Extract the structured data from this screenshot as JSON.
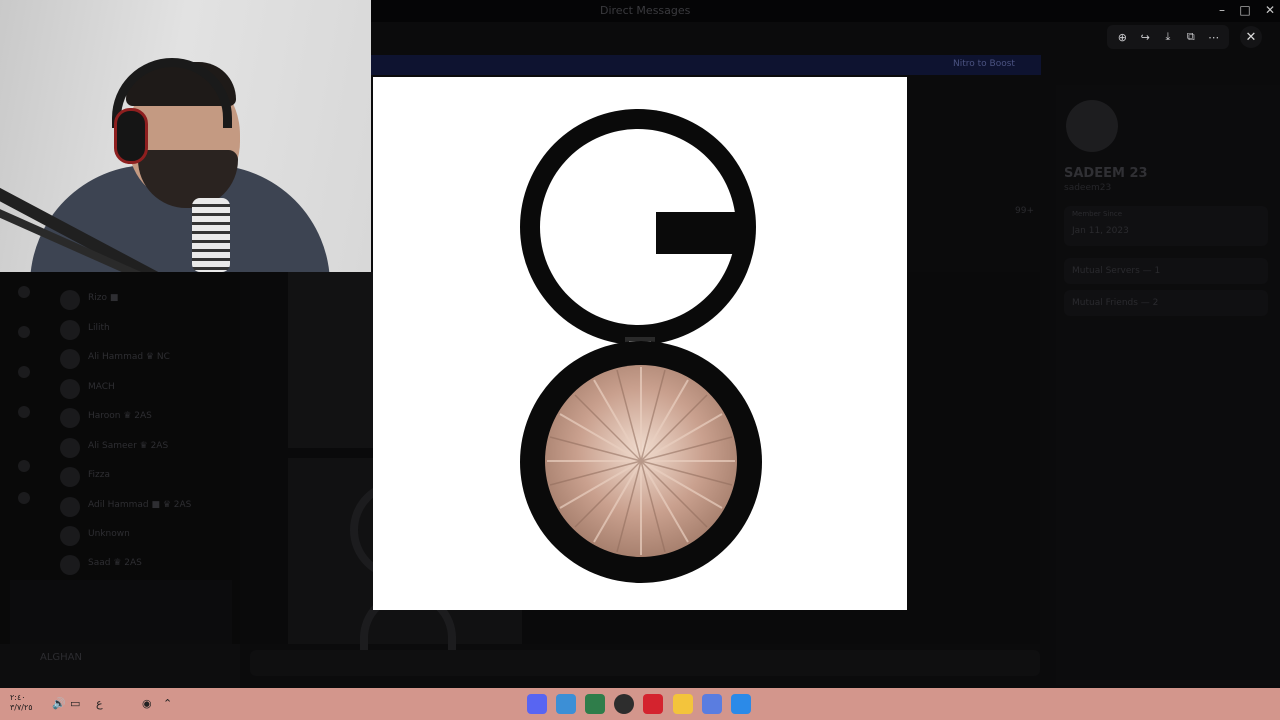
{
  "app": {
    "window_title": "Direct Messages",
    "banner_text": "Nitro to Boost"
  },
  "window_controls": {
    "minimize": "–",
    "maximize": "□",
    "close": "✕"
  },
  "dm_list": [
    {
      "name": "Rizo ■"
    },
    {
      "name": "Lilith"
    },
    {
      "name": "Ali Hammad ♛ NC"
    },
    {
      "name": "MACH"
    },
    {
      "name": "Haroon ♛ 2AS"
    },
    {
      "name": "Ali Sameer ♛ 2AS"
    },
    {
      "name": "Fizza"
    },
    {
      "name": "Adil Hammad ■ ♛ 2AS"
    },
    {
      "name": "Unknown"
    },
    {
      "name": "Saad ♛ 2AS"
    }
  ],
  "user_panel": {
    "username": "ALGHAN"
  },
  "profile": {
    "name": "SADEEM 23",
    "handle": "sadeem23",
    "member_since_label": "Member Since",
    "member_since": "Jan 11, 2023",
    "mutual_servers": "Mutual Servers — 1",
    "mutual_friends": "Mutual Friends — 2"
  },
  "online_count": "99+",
  "viewer": {
    "image_subject": "makeup-compact-highlighter",
    "toolbar": [
      {
        "icon": "zoom-in-icon",
        "glyph": "⊕"
      },
      {
        "icon": "forward-icon",
        "glyph": "↪"
      },
      {
        "icon": "download-icon",
        "glyph": "⤓"
      },
      {
        "icon": "open-external-icon",
        "glyph": "⧉"
      },
      {
        "icon": "more-icon",
        "glyph": "⋯"
      }
    ],
    "close_glyph": "✕"
  },
  "taskbar": {
    "clock_line1": "٢:٤٠",
    "clock_line2": "٣/٧/٢٥",
    "lang": "ع",
    "apps": [
      {
        "name": "discord-app-icon",
        "color": "#5865f2"
      },
      {
        "name": "game-app-icon",
        "color": "#3c8fd6"
      },
      {
        "name": "app-icon-3",
        "color": "#2f7d4a"
      },
      {
        "name": "obs-app-icon",
        "color": "#2d2d2d"
      },
      {
        "name": "adobe-app-icon",
        "color": "#d4232e"
      },
      {
        "name": "file-explorer-icon",
        "color": "#f3c43c"
      },
      {
        "name": "app-icon-7",
        "color": "#5a7de0"
      },
      {
        "name": "windows-store-icon",
        "color": "#2b8ae8"
      }
    ]
  },
  "colors": {
    "compact_black": "#0a0a0a",
    "highlighter_base": "#c9a08e",
    "highlighter_light": "#efd6c8",
    "taskbar": "#d3968c"
  }
}
